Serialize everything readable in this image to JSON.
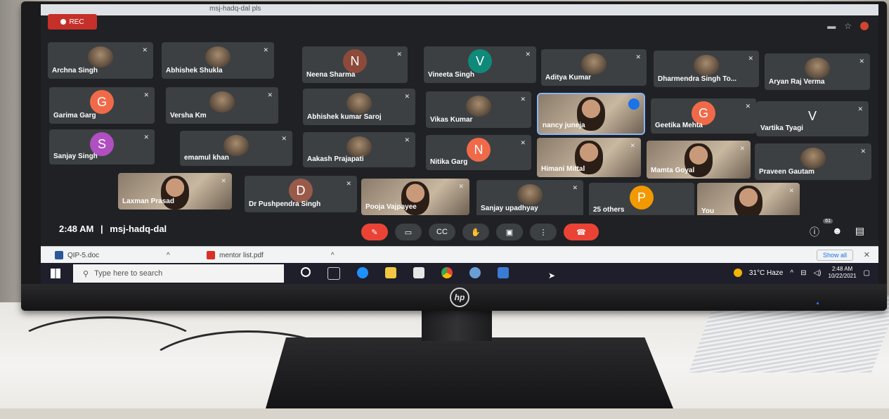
{
  "browser": {
    "tab_title": "msj-hadq-dal pls"
  },
  "recording": {
    "label": "REC"
  },
  "participants": [
    {
      "name": "Archna Singh",
      "type": "photo"
    },
    {
      "name": "Abhishek Shukla",
      "type": "photo"
    },
    {
      "name": "Neena Sharma",
      "type": "initial",
      "initial": "N",
      "color": "#8d4a3a"
    },
    {
      "name": "Vineeta Singh",
      "type": "initial",
      "initial": "V",
      "color": "#0f8a7a"
    },
    {
      "name": "Aditya Kumar",
      "type": "photo"
    },
    {
      "name": "Dharmendra Singh To...",
      "type": "photo"
    },
    {
      "name": "Aryan Raj Verma",
      "type": "photo"
    },
    {
      "name": "Garima Garg",
      "type": "initial",
      "initial": "G",
      "color": "#f06a4a"
    },
    {
      "name": "Versha Km",
      "type": "photo"
    },
    {
      "name": "Abhishek kumar Saroj",
      "type": "photo"
    },
    {
      "name": "Vikas Kumar",
      "type": "photo"
    },
    {
      "name": "nancy juneja",
      "type": "video"
    },
    {
      "name": "Geetika Mehta",
      "type": "initial",
      "initial": "G",
      "color": "#f06a4a"
    },
    {
      "name": "Vartika Tyagi",
      "type": "initial",
      "initial": "V",
      "color": "#3c4043"
    },
    {
      "name": "Sanjay Singh",
      "type": "initial",
      "initial": "S",
      "color": "#b04fc0"
    },
    {
      "name": "emamul khan",
      "type": "photo"
    },
    {
      "name": "Aakash Prajapati",
      "type": "photo"
    },
    {
      "name": "Nitika Garg",
      "type": "initial",
      "initial": "N",
      "color": "#f06a4a"
    },
    {
      "name": "Himani Mittal",
      "type": "video"
    },
    {
      "name": "Mamta Goyal",
      "type": "video"
    },
    {
      "name": "Praveen Gautam",
      "type": "photo"
    },
    {
      "name": "Laxman Prasad",
      "type": "video"
    },
    {
      "name": "Dr Pushpendra Singh",
      "type": "initial",
      "initial": "D",
      "color": "#9a5a4a"
    },
    {
      "name": "Pooja Vajpayee",
      "type": "video"
    },
    {
      "name": "Sanjay upadhyay",
      "type": "photo"
    },
    {
      "name": "25 others",
      "type": "others",
      "initial": "P",
      "color": "#f29900"
    },
    {
      "name": "You",
      "type": "video"
    }
  ],
  "meeting": {
    "time": "2:48 AM",
    "separator": "|",
    "code": "msj-hadq-dal",
    "participants_count": "61",
    "controls": [
      {
        "label": "✎",
        "icon": "mic-off-icon",
        "style": "red"
      },
      {
        "label": "▭",
        "icon": "camera-icon",
        "style": ""
      },
      {
        "label": "CC",
        "icon": "captions-icon",
        "style": ""
      },
      {
        "label": "✋",
        "icon": "raise-hand-icon",
        "style": ""
      },
      {
        "label": "▣",
        "icon": "present-icon",
        "style": ""
      },
      {
        "label": "⋮",
        "icon": "more-options-icon",
        "style": ""
      },
      {
        "label": "☎",
        "icon": "end-call-icon",
        "style": "end"
      }
    ]
  },
  "downloads": {
    "items": [
      {
        "name": "QIP-5.doc",
        "color": "#2b579a"
      },
      {
        "name": "mentor list.pdf",
        "color": "#d93025"
      }
    ],
    "show_all": "Show all",
    "close": "✕"
  },
  "taskbar": {
    "search_placeholder": "Type here to search",
    "weather": "31°C Haze",
    "clock_time": "2:48 AM",
    "clock_date": "10/22/2021"
  },
  "monitor": {
    "brand": "hp"
  }
}
